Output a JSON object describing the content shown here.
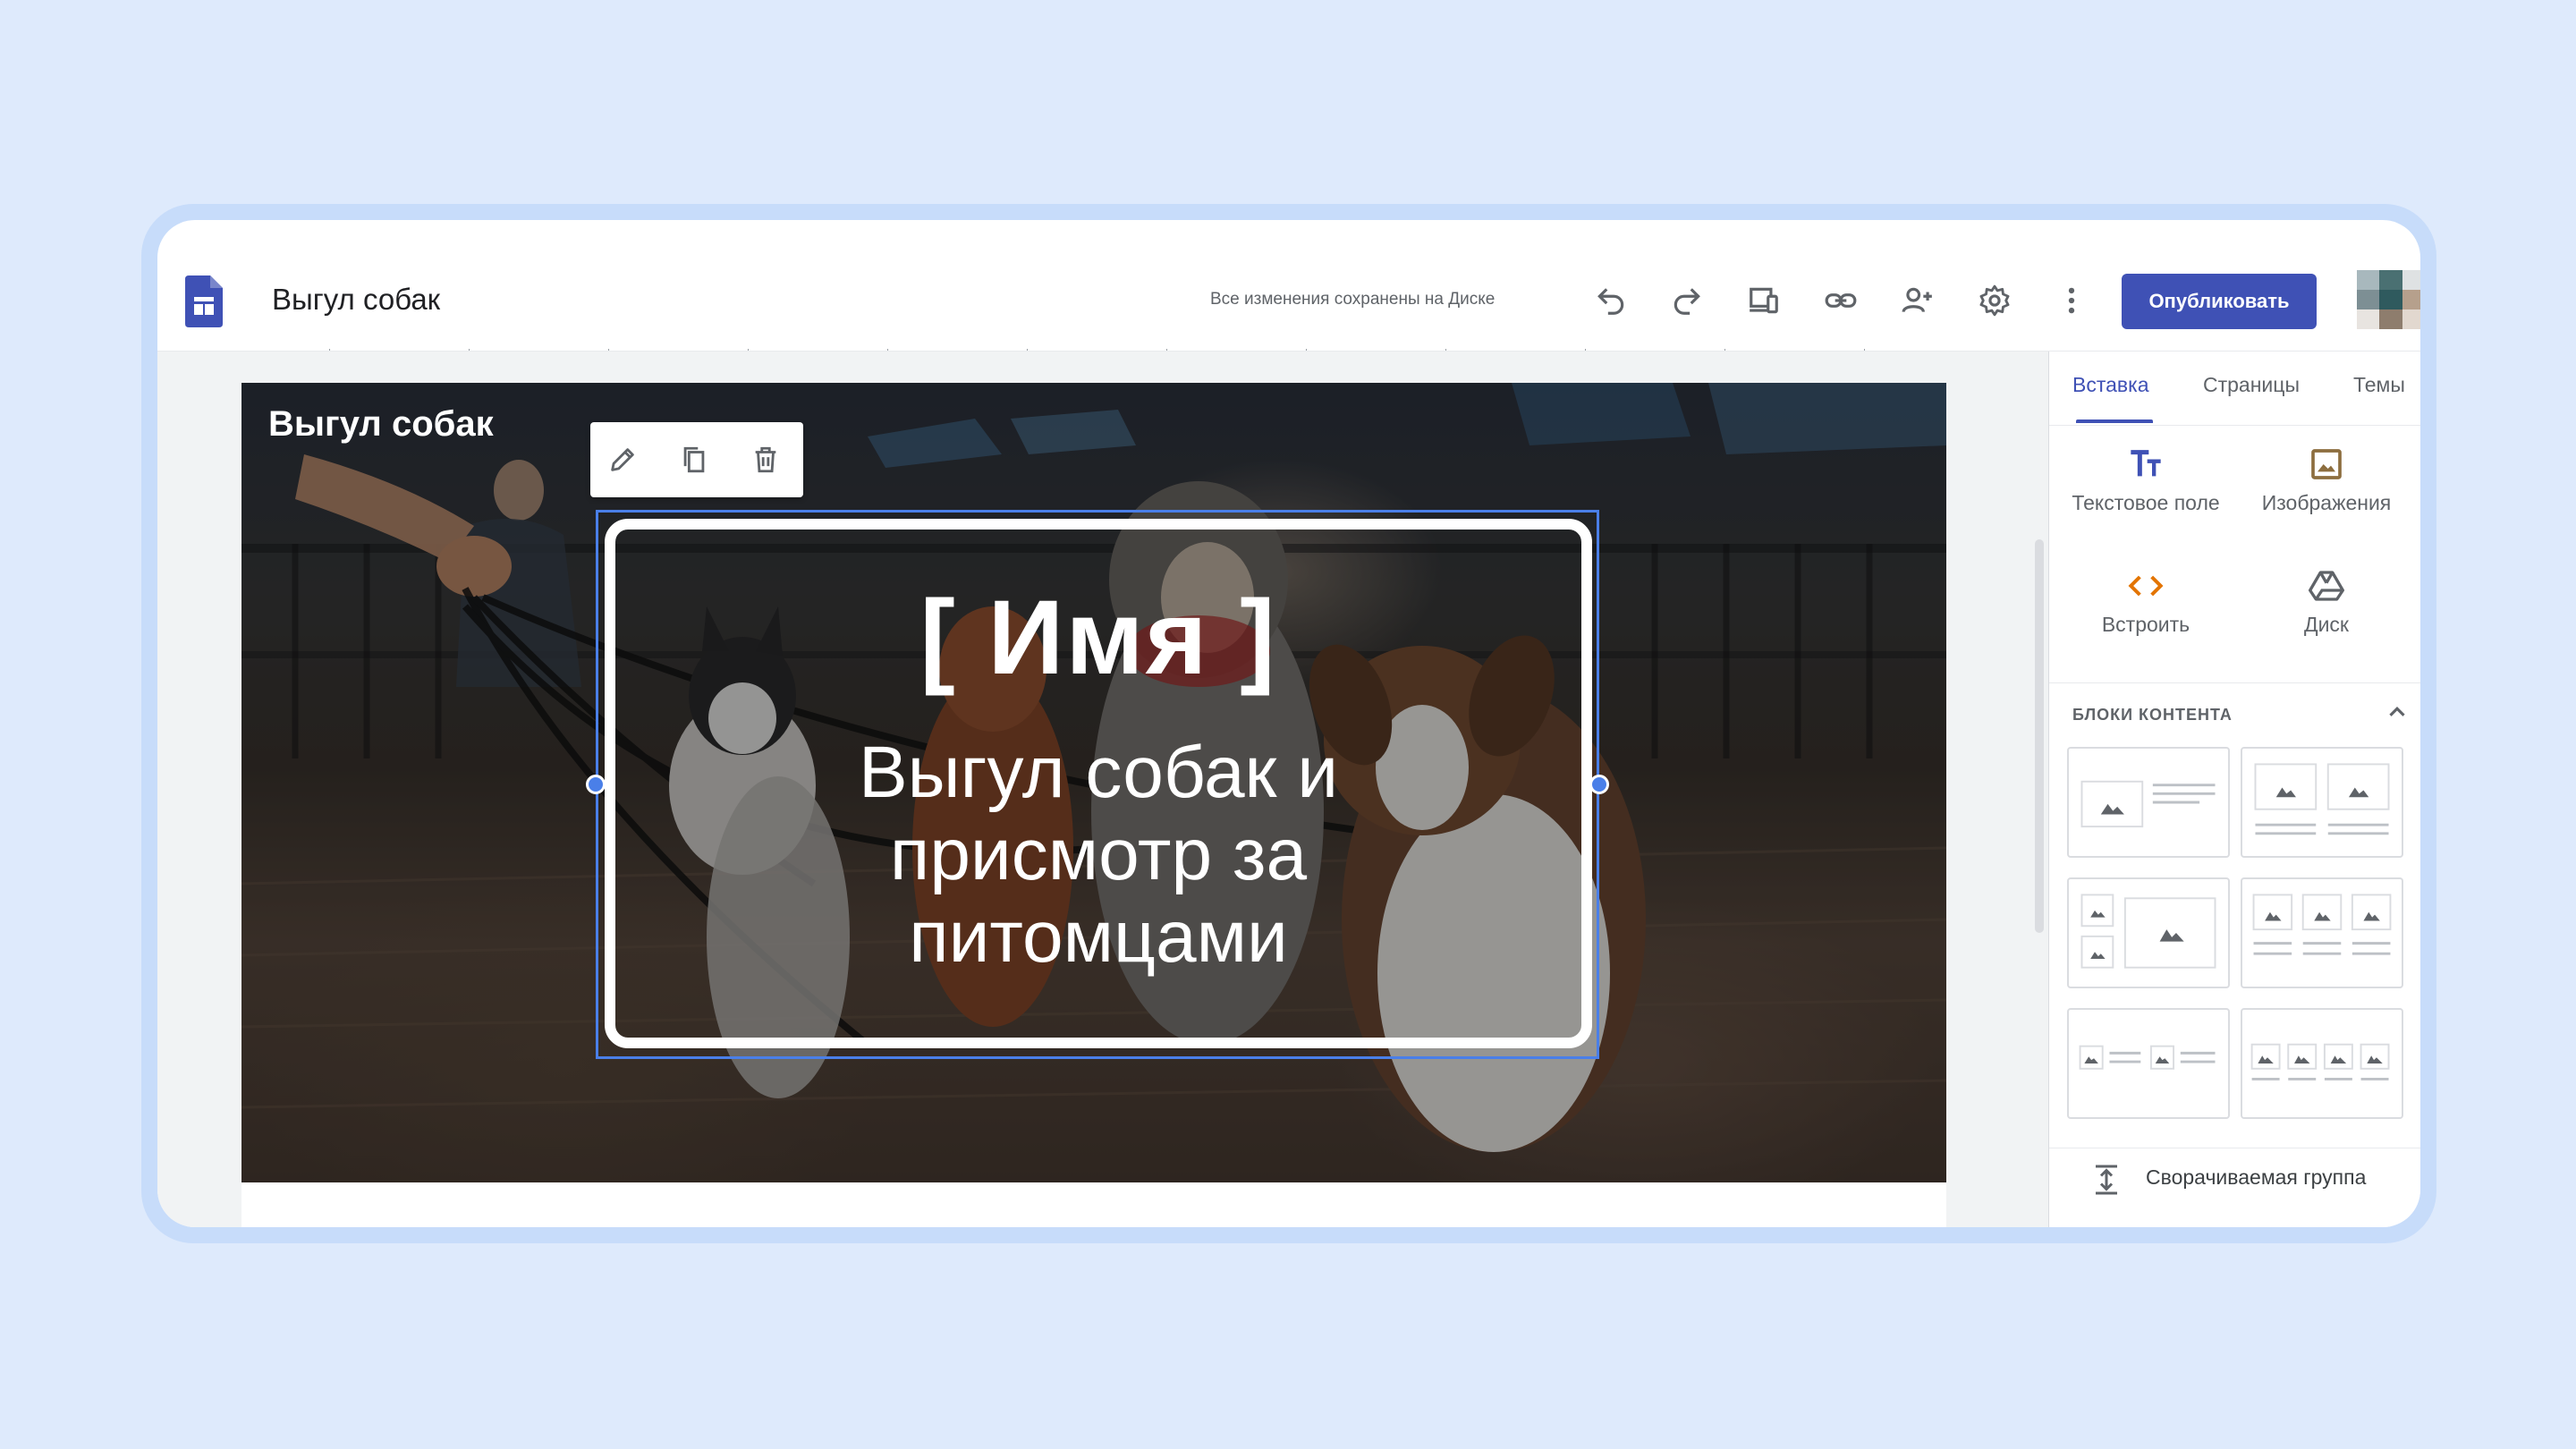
{
  "document": {
    "title": "Выгул собак",
    "save_status": "Все изменения сохранены на Диске"
  },
  "toolbar": {
    "icons": [
      "undo-icon",
      "redo-icon",
      "preview-devices-icon",
      "link-icon",
      "share-add-person-icon",
      "settings-gear-icon",
      "more-vert-icon"
    ],
    "publish_label": "Опубликовать"
  },
  "avatar_colors": [
    "#a8b8bd",
    "#4a7072",
    "#dfe2e3",
    "#7d8f94",
    "#2f5a5e",
    "#b6a08c",
    "#e8e4e0",
    "#8e7d6d",
    "#e2d8cf"
  ],
  "hero": {
    "site_name": "Выгул собак",
    "title": "[ Имя ]",
    "subtitle": "Выгул собак и присмотр за питомцами"
  },
  "edit_toolbar": {
    "icons": [
      "pencil-edit-icon",
      "duplicate-icon",
      "trash-icon"
    ]
  },
  "panel": {
    "tabs": [
      {
        "label": "Вставка",
        "active": true
      },
      {
        "label": "Страницы",
        "active": false
      },
      {
        "label": "Темы",
        "active": false
      }
    ],
    "insert_items": [
      {
        "label": "Текстовое поле",
        "icon": "text-box-icon",
        "color": "#3f51b5"
      },
      {
        "label": "Изображения",
        "icon": "image-icon",
        "color": "#8d6e3f"
      },
      {
        "label": "Встроить",
        "icon": "embed-code-icon",
        "color": "#e37400"
      },
      {
        "label": "Диск",
        "icon": "drive-icon",
        "color": "#5f6368"
      }
    ],
    "content_blocks_title": "БЛОКИ КОНТЕНТА",
    "collapsible_group_label": "Сворачиваемая группа"
  },
  "colors": {
    "accent": "#3f51b5",
    "selection": "#4a7fe8",
    "background": "#deeafc"
  }
}
